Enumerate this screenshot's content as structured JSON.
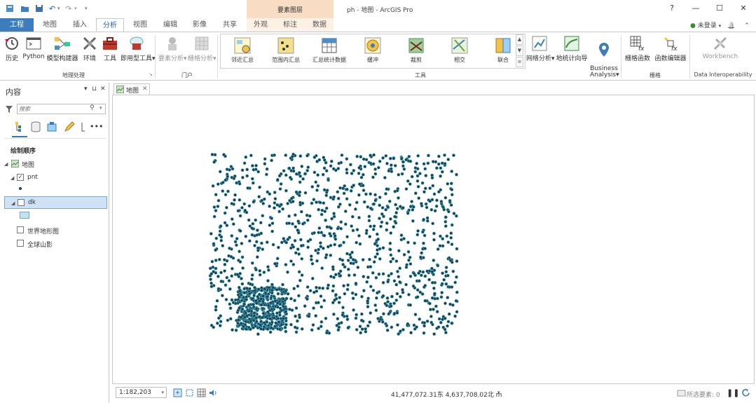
{
  "window": {
    "title": "ph - 地图 - ArcGIS Pro",
    "context_group": "要素图层",
    "help": "?",
    "minimize": "—",
    "maximize": "☐",
    "close": "✕"
  },
  "tabs": [
    {
      "label": "工程"
    },
    {
      "label": "地图"
    },
    {
      "label": "插入"
    },
    {
      "label": "分析"
    },
    {
      "label": "视图"
    },
    {
      "label": "编辑"
    },
    {
      "label": "影像"
    },
    {
      "label": "共享"
    },
    {
      "label": "外观"
    },
    {
      "label": "标注"
    },
    {
      "label": "数据"
    }
  ],
  "user": {
    "label": "未登录",
    "bell": "🔔",
    "pin": "⌃"
  },
  "ribbon": {
    "geoprocessing": {
      "items": [
        "历史",
        "Python",
        "模型构建器",
        "环境",
        "工具",
        "即用型工具"
      ],
      "label": "地理处理"
    },
    "portal": {
      "items": [
        "要素分析",
        "栅格分析"
      ],
      "label": "门户"
    },
    "tools": {
      "items": [
        "邻近汇总",
        "范围内汇总",
        "汇总统计数据",
        "缓冲",
        "裁剪",
        "相交",
        "联合"
      ],
      "label": "工具"
    },
    "workflows": {
      "items": [
        "网络分析",
        "地统计向导",
        "Business\nAnalysis"
      ]
    },
    "raster": {
      "items": [
        "栅格函数",
        "函数编辑器"
      ],
      "label": "栅格"
    },
    "interop": {
      "items": [
        "Workbench"
      ],
      "label": "Data Interoperability"
    }
  },
  "contents": {
    "title": "内容",
    "search_placeholder": "搜索",
    "draw_order": "绘制顺序",
    "tree": [
      {
        "label": "地图"
      },
      {
        "label": "pnt",
        "checked": true
      },
      {
        "label": "dk",
        "checked": false
      },
      {
        "label": "世界地形图",
        "checked": false
      },
      {
        "label": "全球山影",
        "checked": false
      }
    ]
  },
  "map": {
    "tab_label": "地图",
    "point_color": "#1e3e52",
    "point_stroke": "#4ab7c9"
  },
  "status": {
    "scale": "1:182,203",
    "coordinates": "41,477,072.31东 4,637,708.02北 m",
    "selected": "所选要素: 0"
  }
}
